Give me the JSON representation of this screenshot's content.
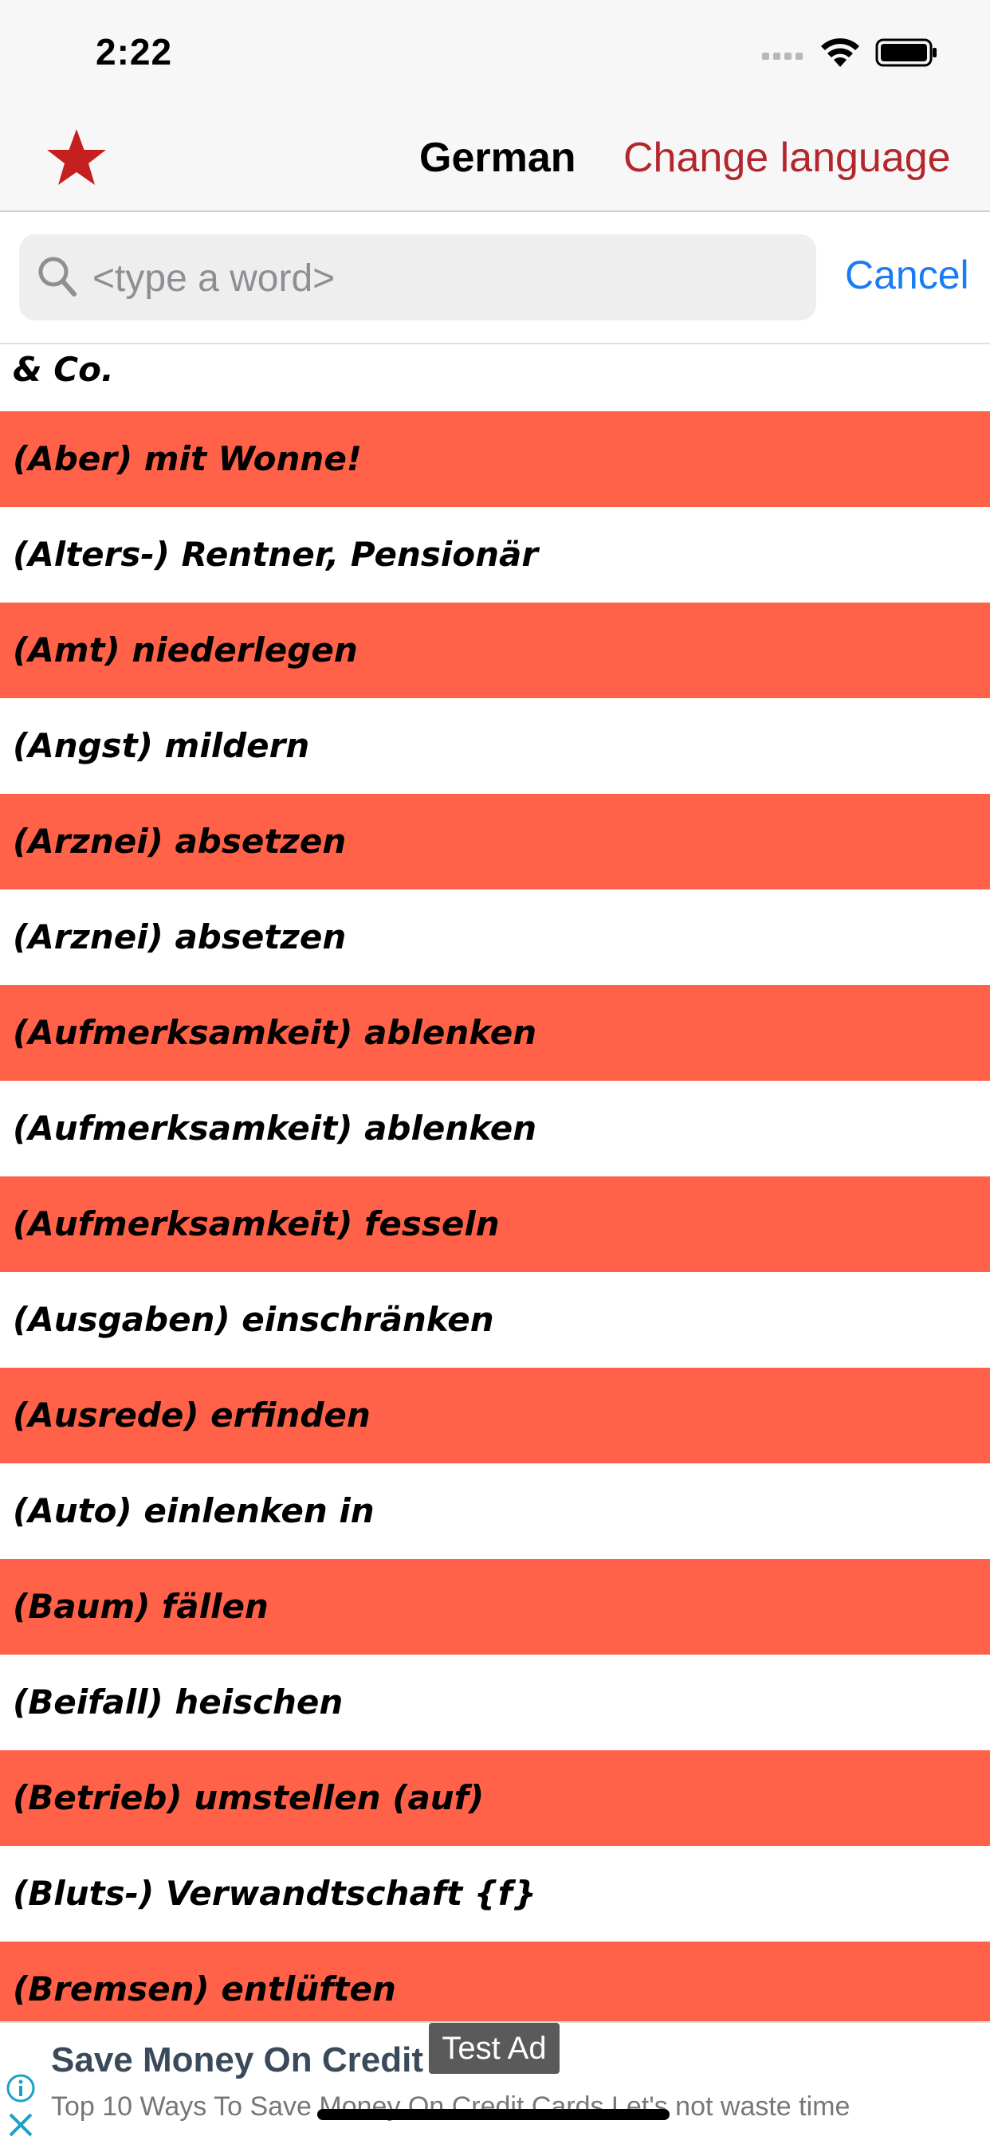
{
  "status_bar": {
    "time": "2:22"
  },
  "nav": {
    "favorites_icon": "star-icon",
    "language": "German",
    "change_language": "Change language"
  },
  "search": {
    "placeholder": "<type a word>",
    "value": "",
    "cancel": "Cancel"
  },
  "colors": {
    "highlight_row": "#ff6249",
    "accent_red": "#b3262c",
    "link_blue": "#1a7cf5"
  },
  "list": {
    "items": [
      "& Co.",
      "(Aber) mit Wonne!",
      "(Alters-) Rentner, Pensionär",
      "(Amt) niederlegen",
      "(Angst) mildern",
      "(Arznei) absetzen",
      "(Arznei) absetzen",
      "(Aufmerksamkeit) ablenken",
      "(Aufmerksamkeit) ablenken",
      "(Aufmerksamkeit) fesseln",
      "(Ausgaben) einschränken",
      "(Ausrede) erfinden",
      "(Auto) einlenken in",
      "(Baum) fällen",
      "(Beifall) heischen",
      "(Betrieb) umstellen (auf)",
      "(Bluts-) Verwandtschaft {f}",
      "(Bremsen) entlüften"
    ]
  },
  "ad": {
    "title": "Save Money On Credit",
    "text": "Top 10 Ways To Save Money On Credit Cards Let's not waste time",
    "badge": "Test Ad"
  }
}
